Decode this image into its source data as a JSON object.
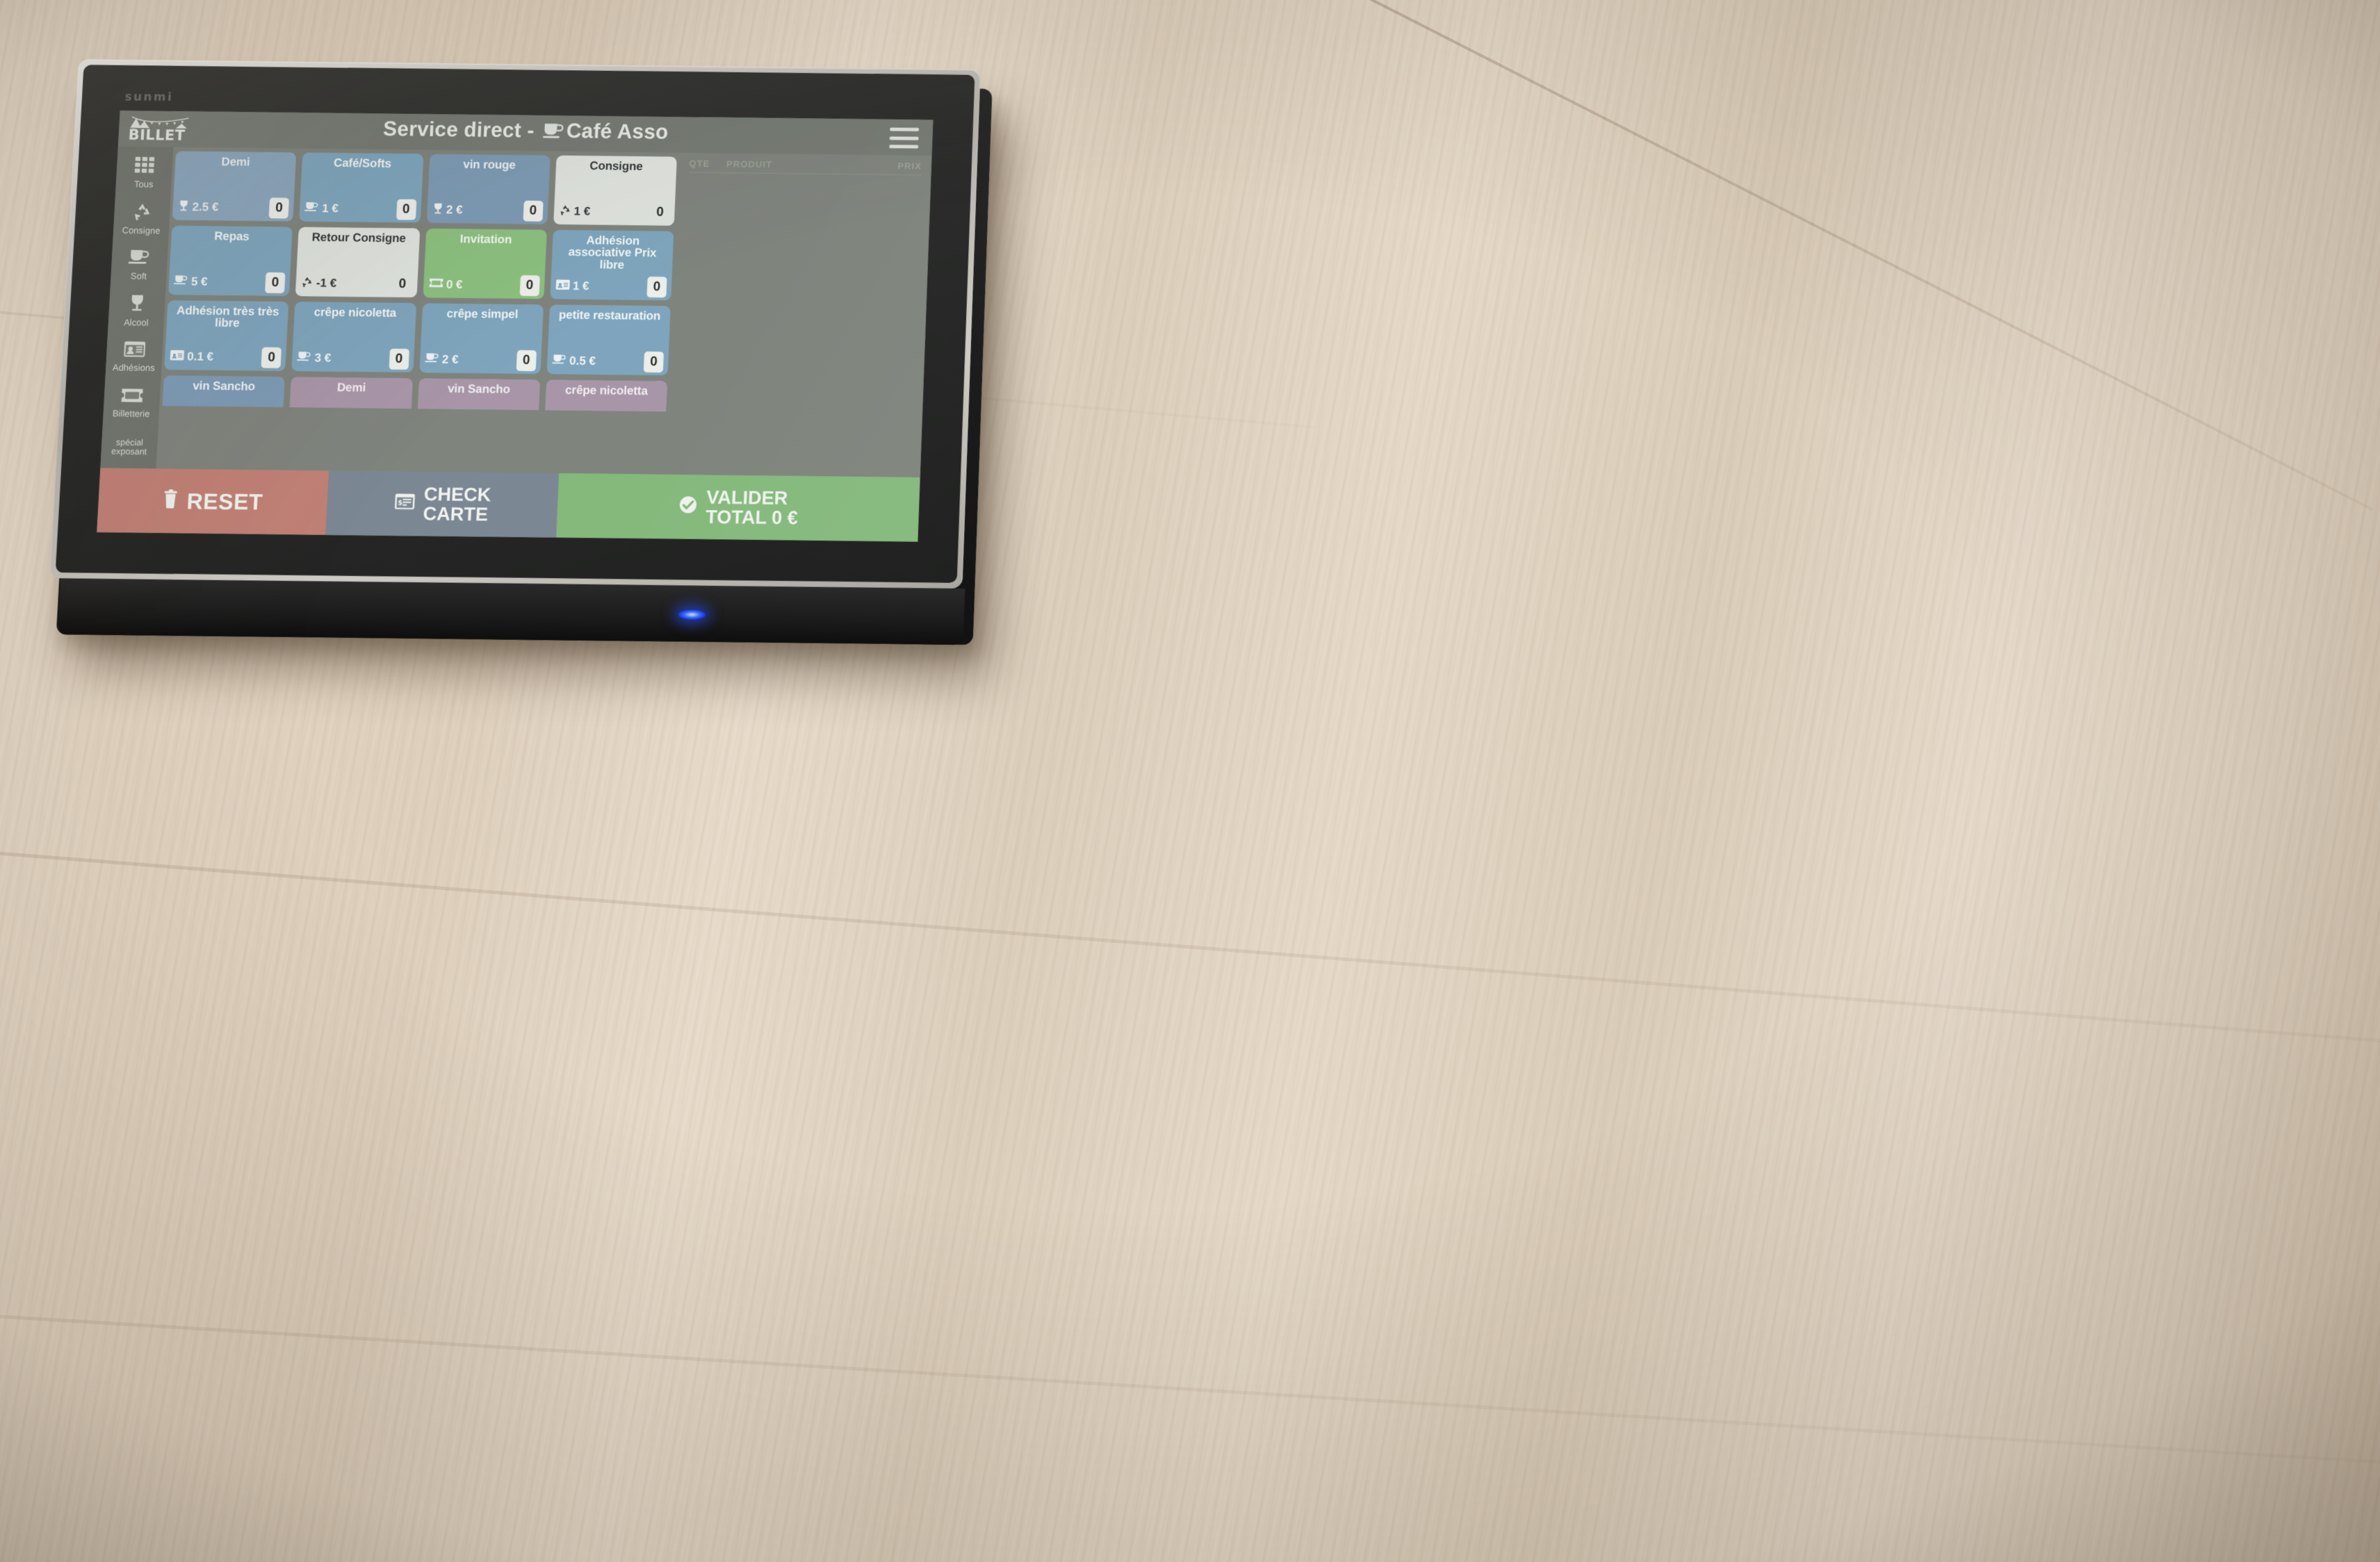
{
  "device": {
    "brand_logo": "sunmi",
    "power_led": "power-led"
  },
  "app": {
    "brand_name": "BILLET",
    "header_title_prefix": "Service direct - ",
    "header_title_suffix": "Café Asso",
    "menu_icon": "hamburger-menu"
  },
  "sidebar": {
    "items": [
      {
        "label": "Tous",
        "icon": "grid-icon"
      },
      {
        "label": "Consigne",
        "icon": "recycle-icon"
      },
      {
        "label": "Soft",
        "icon": "coffee-cup-icon"
      },
      {
        "label": "Alcool",
        "icon": "wine-glass-icon"
      },
      {
        "label": "Adhésions",
        "icon": "id-card-icon"
      },
      {
        "label": "Billetterie",
        "icon": "ticket-icon"
      },
      {
        "label": "spécial exposant",
        "icon": "none"
      }
    ]
  },
  "products": [
    {
      "name": "Demi",
      "price": "2.5 €",
      "qty": "0",
      "icon": "wine-glass-icon",
      "style": "t-blue-lt",
      "qty_flat": false
    },
    {
      "name": "Café/Softs",
      "price": "1 €",
      "qty": "0",
      "icon": "coffee-cup-icon",
      "style": "t-blue",
      "qty_flat": false
    },
    {
      "name": "vin rouge",
      "price": "2 €",
      "qty": "0",
      "icon": "wine-glass-icon",
      "style": "t-blue-dk",
      "qty_flat": false
    },
    {
      "name": "Consigne",
      "price": "1 €",
      "qty": "0",
      "icon": "recycle-icon",
      "style": "t-white",
      "qty_flat": true
    },
    {
      "name": "Repas",
      "price": "5 €",
      "qty": "0",
      "icon": "coffee-cup-icon",
      "style": "t-blue",
      "qty_flat": false
    },
    {
      "name": "Retour Consigne",
      "price": "-1 €",
      "qty": "0",
      "icon": "recycle-icon",
      "style": "t-white",
      "qty_flat": true
    },
    {
      "name": "Invitation",
      "price": "0 €",
      "qty": "0",
      "icon": "ticket-icon",
      "style": "t-green",
      "qty_flat": false
    },
    {
      "name": "Adhésion associative Prix libre",
      "price": "1 €",
      "qty": "0",
      "icon": "id-card-icon",
      "style": "t-blue",
      "qty_flat": false
    },
    {
      "name": "Adhésion très très libre",
      "price": "0.1 €",
      "qty": "0",
      "icon": "id-card-icon",
      "style": "t-blue",
      "qty_flat": false
    },
    {
      "name": "crêpe nicoletta",
      "price": "3 €",
      "qty": "0",
      "icon": "coffee-cup-icon",
      "style": "t-blue",
      "qty_flat": false
    },
    {
      "name": "crêpe simpel",
      "price": "2 €",
      "qty": "0",
      "icon": "coffee-cup-icon",
      "style": "t-blue",
      "qty_flat": false
    },
    {
      "name": "petite restauration",
      "price": "0.5 €",
      "qty": "0",
      "icon": "coffee-cup-icon",
      "style": "t-blue",
      "qty_flat": false
    }
  ],
  "products_clipped_row": [
    {
      "name": "vin Sancho",
      "style": "t-blue-dk"
    },
    {
      "name": "Demi",
      "style": "t-mauve"
    },
    {
      "name": "vin Sancho",
      "style": "t-mauve"
    },
    {
      "name": "crêpe nicoletta",
      "style": "t-mauve"
    }
  ],
  "ticket": {
    "columns": {
      "qte": "QTE",
      "produit": "PRODUIT",
      "prix": "PRIX"
    },
    "rows": []
  },
  "actions": {
    "reset": {
      "label": "RESET",
      "icon": "trash-icon",
      "color": "#c08076"
    },
    "check_card": {
      "line1": "CHECK",
      "line2": "CARTE",
      "icon": "card-reader-icon",
      "color": "#7c8794"
    },
    "validate": {
      "line1": "VALIDER",
      "line2": "TOTAL 0 €",
      "icon": "check-circle-icon",
      "color": "#85b97c"
    }
  }
}
